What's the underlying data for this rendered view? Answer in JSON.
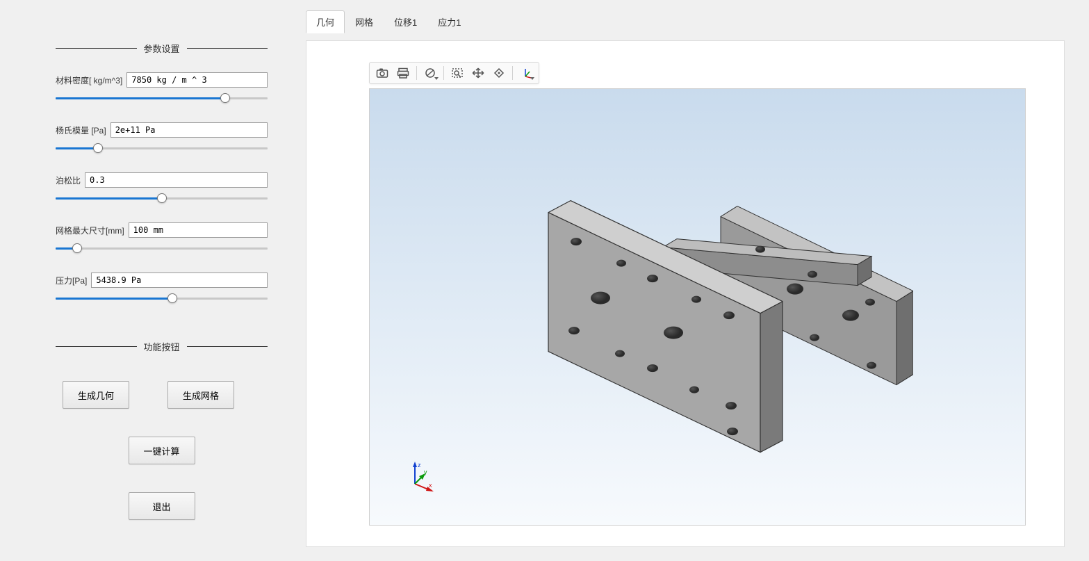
{
  "sidebar": {
    "paramSection": "参数设置",
    "funcSection": "功能按钮",
    "params": [
      {
        "label": "材料密度[ kg/m^3]",
        "value": "7850 kg / m ^ 3",
        "sliderPct": 80
      },
      {
        "label": "杨氏模量 [Pa]",
        "value": "2e+11 Pa",
        "sliderPct": 20
      },
      {
        "label": "泊松比",
        "value": "0.3",
        "sliderPct": 50
      },
      {
        "label": "网格最大尺寸[mm]",
        "value": "100 mm",
        "sliderPct": 10
      },
      {
        "label": "压力[Pa]",
        "value": "5438.9 Pa",
        "sliderPct": 55
      }
    ],
    "buttons": {
      "geom": "生成几何",
      "mesh": "生成网格",
      "solve": "一键计算",
      "exit": "退出"
    }
  },
  "tabs": [
    {
      "label": "几何",
      "active": true
    },
    {
      "label": "网格",
      "active": false
    },
    {
      "label": "位移1",
      "active": false
    },
    {
      "label": "应力1",
      "active": false
    }
  ],
  "toolbar": {
    "icons": [
      "camera",
      "print",
      "|",
      "block",
      "|",
      "zoom-box",
      "pan",
      "rotate",
      "|",
      "axes"
    ]
  },
  "axesLabels": {
    "x": "x",
    "y": "y",
    "z": "z"
  }
}
